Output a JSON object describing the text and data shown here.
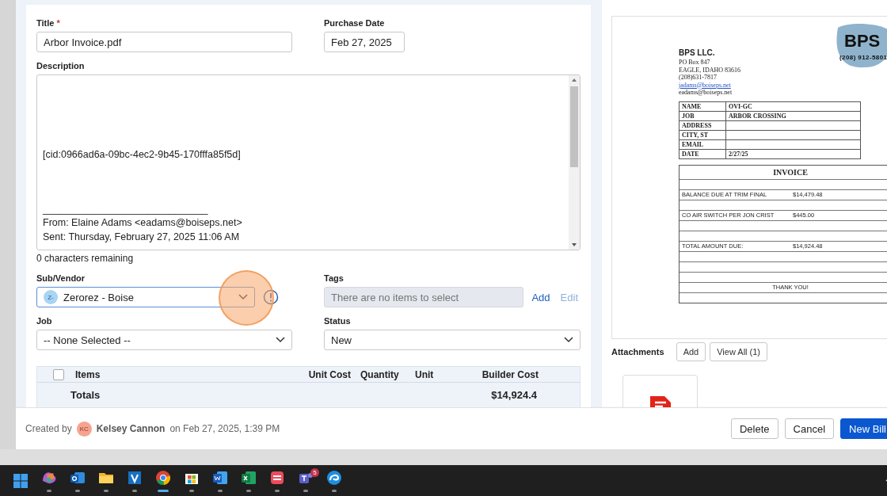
{
  "form": {
    "title": {
      "label": "Title",
      "required_mark": "*",
      "value": "Arbor Invoice.pdf"
    },
    "purchase_date": {
      "label": "Purchase Date",
      "value": "Feb 27, 2025"
    },
    "description": {
      "label": "Description",
      "text": "[cid:0966ad6a-09bc-4ec2-9b45-170fffa85f5d]\n\n\n\n______________________________\nFrom: Elaine Adams <eadams@boiseps.net>\nSent: Thursday, February 27, 2025 11:06 AM",
      "remaining": "0 characters remaining"
    },
    "sub_vendor": {
      "label": "Sub/Vendor",
      "avatar": "Z-",
      "value": "Zerorez - Boise",
      "highlighted": true
    },
    "tags": {
      "label": "Tags",
      "placeholder": "There are no items to select",
      "actions": [
        {
          "label": "Add",
          "disabled": false
        },
        {
          "label": "Edit",
          "disabled": true
        }
      ]
    },
    "job": {
      "label": "Job",
      "value": "-- None Selected --"
    },
    "status": {
      "label": "Status",
      "value": "New"
    }
  },
  "items_table": {
    "checked": false,
    "columns": [
      "Items",
      "Unit Cost",
      "Quantity",
      "Unit",
      "Builder Cost"
    ],
    "totals_label": "Totals",
    "totals_value": "$14,924.4"
  },
  "document": {
    "logo": {
      "name": "BPS",
      "phone": "(208) 912-5801"
    },
    "company": "BPS LLC.",
    "address_lines": [
      "PO Box 847",
      "EAGLE, IDAHO 83616",
      "(208)631-7817"
    ],
    "link": "jadams@boiseps.net",
    "email": "eadams@boiseps.net",
    "info_rows": [
      {
        "label": "NAME",
        "value": "OVI-GC"
      },
      {
        "label": "JOB",
        "value": "ARBOR CROSSING"
      },
      {
        "label": "ADDRESS"
      },
      {
        "label": "CITY, ST"
      },
      {
        "label": "EMAIL"
      },
      {
        "label": "DATE",
        "value": "2/27/25"
      }
    ],
    "invoice_rows": [
      {
        "kind": "heading",
        "text": "INVOICE"
      },
      {
        "kind": "blank"
      },
      {
        "kind": "line",
        "text": "BALANCE DUE AT TRIM FINAL",
        "amount": "$14,479.48"
      },
      {
        "kind": "blank"
      },
      {
        "kind": "line",
        "text": "CO AIR SWITCH PER JON CRIST",
        "amount": "$445.00"
      },
      {
        "kind": "blank"
      },
      {
        "kind": "blank"
      },
      {
        "kind": "line",
        "text": "TOTAL AMOUNT DUE:",
        "amount": "$14,924.48"
      },
      {
        "kind": "blank"
      },
      {
        "kind": "blank"
      },
      {
        "kind": "blank"
      },
      {
        "kind": "center",
        "text": "THANK YOU!"
      },
      {
        "kind": "blank"
      }
    ]
  },
  "attachments": {
    "label": "Attachments",
    "buttons": [
      "Add",
      "View All (1)"
    ]
  },
  "footer": {
    "created_by": "Created by",
    "avatar": "KC",
    "name": "Kelsey Cannon",
    "date": "on Feb 27, 2025, 1:39 PM",
    "buttons": [
      {
        "label": "Delete",
        "kind": "plain"
      },
      {
        "label": "Cancel",
        "kind": "plain"
      },
      {
        "label": "New Bill",
        "kind": "primary"
      }
    ]
  },
  "taskbar": {
    "apps": [
      {
        "kind": "start",
        "active": false
      },
      {
        "kind": "m365",
        "active": false
      },
      {
        "kind": "outlook",
        "active": false
      },
      {
        "kind": "explorer",
        "active": false
      },
      {
        "kind": "v",
        "active": false
      },
      {
        "kind": "chrome",
        "active": true
      },
      {
        "kind": "store",
        "active": false
      },
      {
        "kind": "word",
        "active": false
      },
      {
        "kind": "excel",
        "active": false
      },
      {
        "kind": "todo",
        "active": false
      },
      {
        "kind": "teams",
        "active": false,
        "badge": "5"
      },
      {
        "kind": "edge",
        "active": false
      }
    ]
  }
}
